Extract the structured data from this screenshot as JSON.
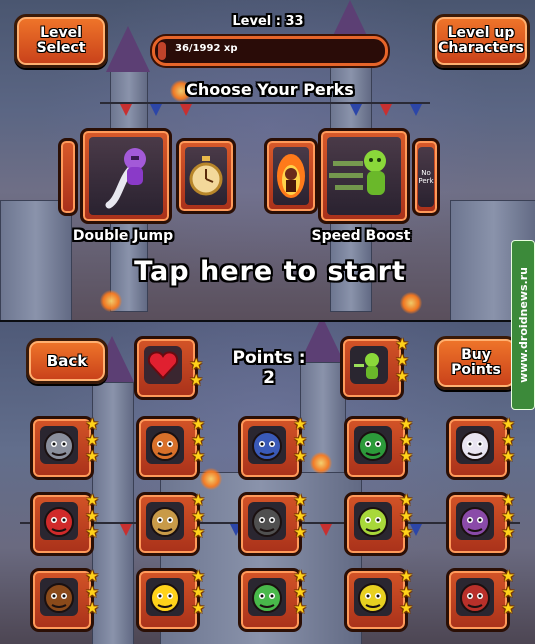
{
  "top": {
    "level_select_label": "Level\nSelect",
    "level_up_label": "Level up\nCharacters",
    "level_text": "Level : 33",
    "xp_text": "36/1992 xp",
    "xp_progress": 0.018,
    "choose_perks_title": "Choose Your Perks",
    "perks": [
      {
        "label": "Double Jump",
        "icon": "purple-knight-jump-icon"
      },
      {
        "label": "Speed Boost",
        "icon": "green-runner-speed-icon"
      }
    ],
    "small_perk_icons": [
      "stopwatch-icon",
      "fire-figure-icon",
      "no-perk-icon"
    ],
    "no_perk_text": "No\nPerk",
    "tap_start": "Tap here to start"
  },
  "bottom": {
    "back_label": "Back",
    "buy_points_label": "Buy\nPoints",
    "points_label": "Points :",
    "points_value": "2",
    "heart_icon": "heart-icon",
    "characters": [
      {
        "name": "knight",
        "icon": "knight-helmet-icon",
        "color": "#8a8f9c",
        "stars": 3
      },
      {
        "name": "viking",
        "icon": "viking-helmet-icon",
        "color": "#d8702a",
        "stars": 3
      },
      {
        "name": "wizard",
        "icon": "wizard-hat-icon",
        "color": "#3a5ab8",
        "stars": 3
      },
      {
        "name": "ninja-green",
        "icon": "green-hood-icon",
        "color": "#2c9a3a",
        "stars": 3
      },
      {
        "name": "unicorn",
        "icon": "unicorn-icon",
        "color": "#e8e4f0",
        "stars": 3
      },
      {
        "name": "dragon",
        "icon": "red-dragon-icon",
        "color": "#d02a2a",
        "stars": 3
      },
      {
        "name": "yeti",
        "icon": "tan-beast-icon",
        "color": "#c89a48",
        "stars": 3
      },
      {
        "name": "ninja",
        "icon": "ninja-mask-icon",
        "color": "#505050",
        "stars": 3
      },
      {
        "name": "cyclops",
        "icon": "green-eyeball-icon",
        "color": "#a8d83a",
        "stars": 3
      },
      {
        "name": "ogre",
        "icon": "purple-ogre-icon",
        "color": "#8a4aa8",
        "stars": 3
      },
      {
        "name": "monkey",
        "icon": "monkey-icon",
        "color": "#8a4a1a",
        "stars": 3
      },
      {
        "name": "chick",
        "icon": "yellow-chick-icon",
        "color": "#ffd21a",
        "stars": 3
      },
      {
        "name": "frog",
        "icon": "green-frog-icon",
        "color": "#48b84a",
        "stars": 3
      },
      {
        "name": "bug",
        "icon": "rainbow-bug-icon",
        "color": "#e8d020",
        "stars": 3
      },
      {
        "name": "bull",
        "icon": "red-bull-icon",
        "color": "#b8302a",
        "stars": 3
      }
    ]
  },
  "watermark": "www.droidnews.ru"
}
